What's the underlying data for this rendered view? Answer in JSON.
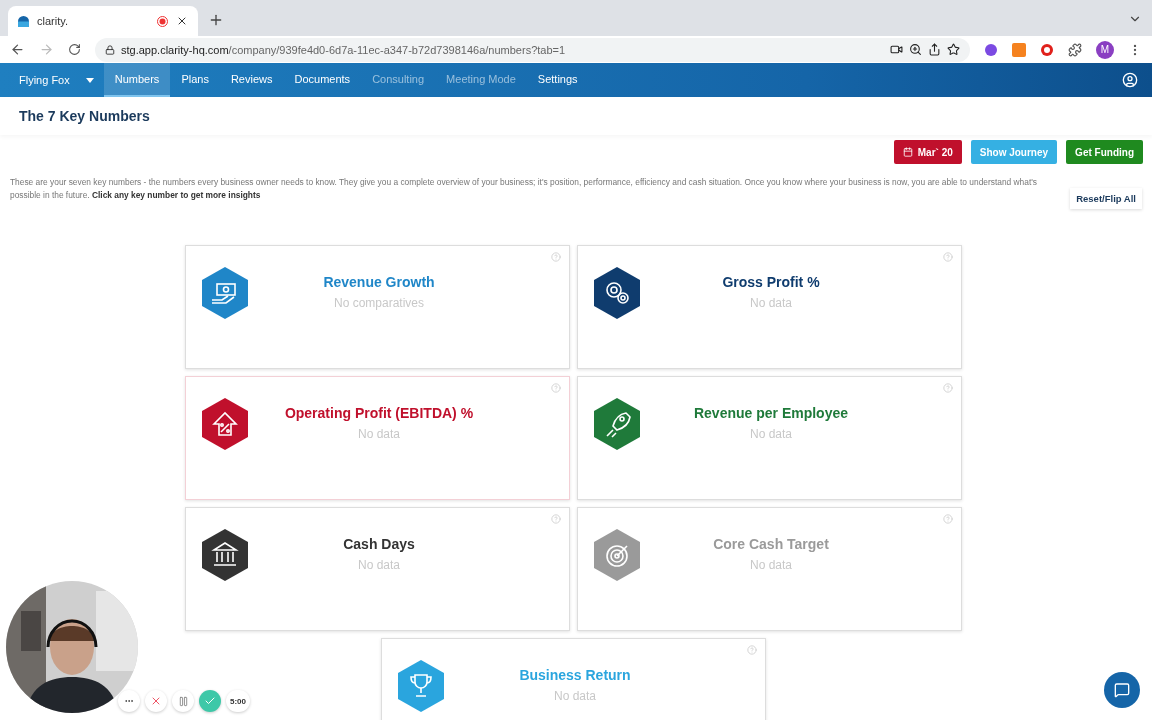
{
  "browser": {
    "tab_title": "clarity.",
    "url_host": "stg.app.clarity-hq.com",
    "url_path": "/company/939fe4d0-6d7a-11ec-a347-b72d7398146a/numbers?tab=1",
    "profile_initial": "M"
  },
  "nav": {
    "company": "Flying Fox",
    "items": [
      {
        "label": "Numbers",
        "selected": true,
        "disabled": false
      },
      {
        "label": "Plans",
        "selected": false,
        "disabled": false
      },
      {
        "label": "Reviews",
        "selected": false,
        "disabled": false
      },
      {
        "label": "Documents",
        "selected": false,
        "disabled": false
      },
      {
        "label": "Consulting",
        "selected": false,
        "disabled": true
      },
      {
        "label": "Meeting Mode",
        "selected": false,
        "disabled": true
      },
      {
        "label": "Settings",
        "selected": false,
        "disabled": false
      }
    ]
  },
  "page_title": "The 7 Key Numbers",
  "actions": [
    {
      "kind": "date",
      "label": "Mar` 20",
      "color": "#c0102c"
    },
    {
      "kind": "plain",
      "label": "Show Journey",
      "color": "#35b0e3"
    },
    {
      "kind": "plain",
      "label": "Get Funding",
      "color": "#1f8a1f"
    }
  ],
  "description": "These are your seven key numbers - the numbers every business owner needs to know. They give you a complete overview of your business; it's position, performance, efficiency and cash situation. Once you know where your business is now, you are able to understand what's possible in the future. **Click any key number to get more insights**",
  "reset_button": "Reset/Flip All",
  "cards": [
    {
      "title": "Revenue Growth",
      "status": "No comparatives",
      "kind": "money",
      "color": "#1f86c8"
    },
    {
      "title": "Gross Profit %",
      "status": "No data",
      "kind": "gears",
      "color": "#0f3c6e"
    },
    {
      "title": "Operating Profit (EBITDA) %",
      "status": "No data",
      "kind": "percent",
      "color": "#c0102c"
    },
    {
      "title": "Revenue per Employee",
      "status": "No data",
      "kind": "rocket",
      "color": "#1f7a3a"
    },
    {
      "title": "Cash Days",
      "status": "No data",
      "kind": "bank",
      "color": "#333333"
    },
    {
      "title": "Core Cash Target",
      "status": "No data",
      "kind": "target",
      "color": "#9a9a9a"
    },
    {
      "title": "Business Return",
      "status": "No data",
      "kind": "trophy",
      "color": "#2aa5de"
    }
  ],
  "recorder": {
    "timer": "5:00"
  }
}
